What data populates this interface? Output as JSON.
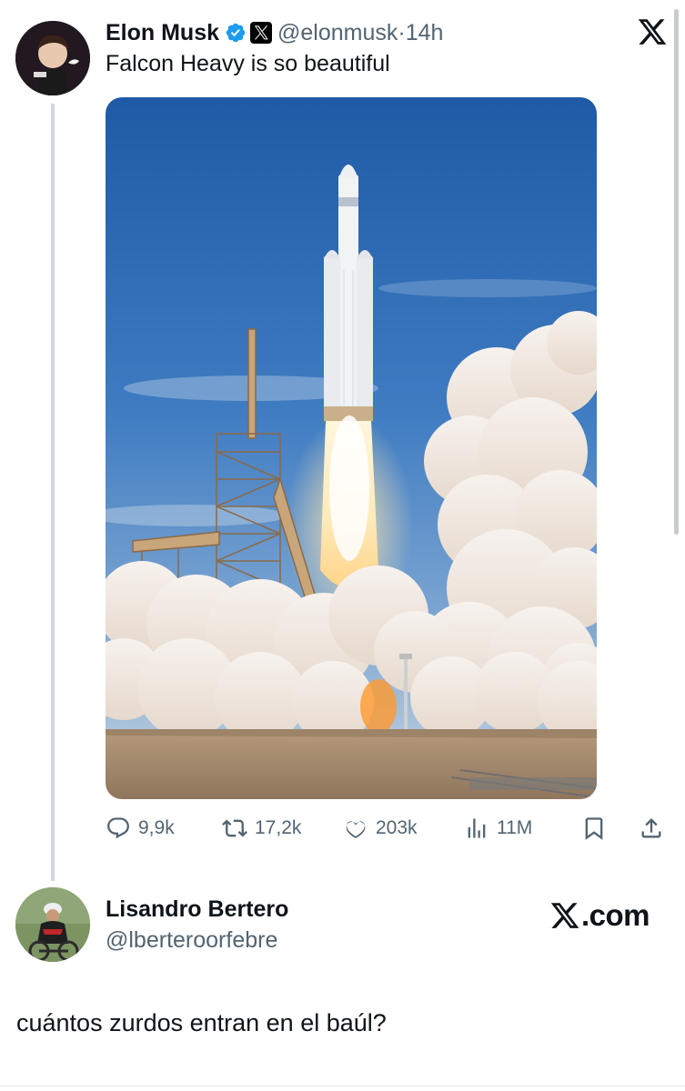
{
  "tweet": {
    "author_name": "Elon Musk",
    "handle": "@elonmusk",
    "separator": "·",
    "time": "14h",
    "text": "Falcon Heavy is so beautiful",
    "verified_icon": "verified-badge-icon",
    "affiliation_icon": "x-affiliation-icon",
    "media_alt": "Falcon Heavy rocket launch",
    "actions": {
      "replies": "9,9k",
      "retweets": "17,2k",
      "likes": "203k",
      "views": "11M"
    }
  },
  "reply": {
    "author_name": "Lisandro Bertero",
    "handle": "@lberteroorfebre",
    "text": "cuántos zurdos entran en el baúl?"
  },
  "watermark": {
    "text": ".com"
  },
  "colors": {
    "text_primary": "#0f1419",
    "text_secondary": "#536471",
    "verified_blue": "#1d9bf0",
    "thread_line": "#cfd9de"
  }
}
